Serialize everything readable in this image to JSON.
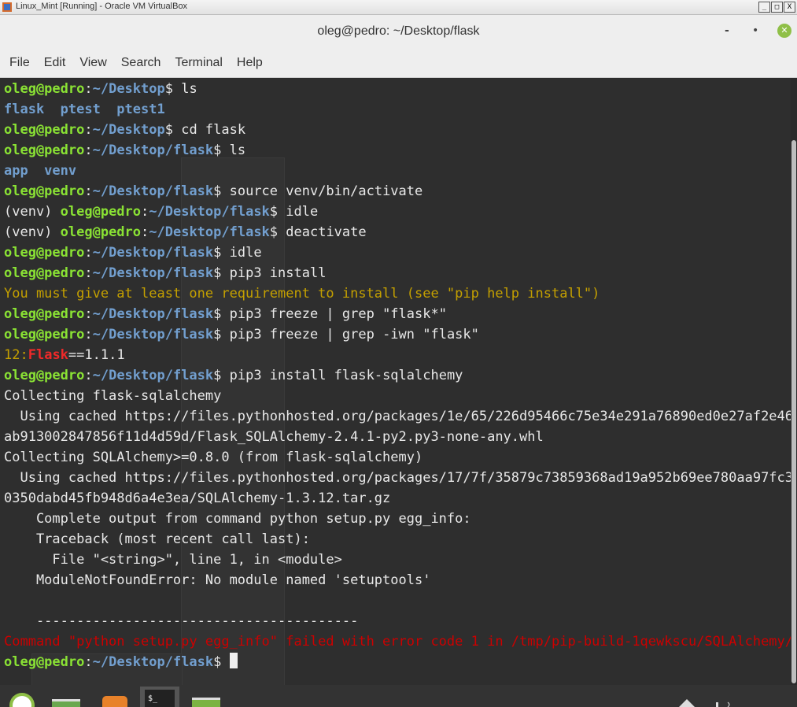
{
  "vbox": {
    "title": "Linux_Mint [Running] - Oracle VM VirtualBox",
    "controls": [
      "_",
      "□",
      "X"
    ]
  },
  "window": {
    "title": "oleg@pedro: ~/Desktop/flask",
    "min": "-",
    "max": "•",
    "close": "✕"
  },
  "menu": [
    "File",
    "Edit",
    "View",
    "Search",
    "Terminal",
    "Help"
  ],
  "prompt": {
    "user": "oleg@pedro",
    "sep": ":"
  },
  "lines": [
    [
      {
        "t": "oleg@pedro",
        "c": "g"
      },
      {
        "t": ":",
        "c": ""
      },
      {
        "t": "~/Desktop",
        "c": "b"
      },
      {
        "t": "$ ls",
        "c": ""
      }
    ],
    [
      {
        "t": "flask  ptest  ptest1",
        "c": "b"
      }
    ],
    [
      {
        "t": "oleg@pedro",
        "c": "g"
      },
      {
        "t": ":",
        "c": ""
      },
      {
        "t": "~/Desktop",
        "c": "b"
      },
      {
        "t": "$ cd flask",
        "c": ""
      }
    ],
    [
      {
        "t": "oleg@pedro",
        "c": "g"
      },
      {
        "t": ":",
        "c": ""
      },
      {
        "t": "~/Desktop/flask",
        "c": "b"
      },
      {
        "t": "$ ls",
        "c": ""
      }
    ],
    [
      {
        "t": "app  venv",
        "c": "b"
      }
    ],
    [
      {
        "t": "oleg@pedro",
        "c": "g"
      },
      {
        "t": ":",
        "c": ""
      },
      {
        "t": "~/Desktop/flask",
        "c": "b"
      },
      {
        "t": "$ source venv/bin/activate",
        "c": ""
      }
    ],
    [
      {
        "t": "(venv) ",
        "c": ""
      },
      {
        "t": "oleg@pedro",
        "c": "g"
      },
      {
        "t": ":",
        "c": ""
      },
      {
        "t": "~/Desktop/flask",
        "c": "b"
      },
      {
        "t": "$ idle",
        "c": ""
      }
    ],
    [
      {
        "t": "(venv) ",
        "c": ""
      },
      {
        "t": "oleg@pedro",
        "c": "g"
      },
      {
        "t": ":",
        "c": ""
      },
      {
        "t": "~/Desktop/flask",
        "c": "b"
      },
      {
        "t": "$ deactivate",
        "c": ""
      }
    ],
    [
      {
        "t": "oleg@pedro",
        "c": "g"
      },
      {
        "t": ":",
        "c": ""
      },
      {
        "t": "~/Desktop/flask",
        "c": "b"
      },
      {
        "t": "$ idle",
        "c": ""
      }
    ],
    [
      {
        "t": "oleg@pedro",
        "c": "g"
      },
      {
        "t": ":",
        "c": ""
      },
      {
        "t": "~/Desktop/flask",
        "c": "b"
      },
      {
        "t": "$ pip3 install",
        "c": ""
      }
    ],
    [
      {
        "t": "You must give at least one requirement to install (see \"pip help install\")",
        "c": "y"
      }
    ],
    [
      {
        "t": "oleg@pedro",
        "c": "g"
      },
      {
        "t": ":",
        "c": ""
      },
      {
        "t": "~/Desktop/flask",
        "c": "b"
      },
      {
        "t": "$ pip3 freeze | grep \"flask*\"",
        "c": ""
      }
    ],
    [
      {
        "t": "oleg@pedro",
        "c": "g"
      },
      {
        "t": ":",
        "c": ""
      },
      {
        "t": "~/Desktop/flask",
        "c": "b"
      },
      {
        "t": "$ pip3 freeze | grep -iwn \"flask\"",
        "c": ""
      }
    ],
    [
      {
        "t": "12",
        "c": "y"
      },
      {
        "t": ":",
        "c": "y"
      },
      {
        "t": "Flask",
        "c": "rb"
      },
      {
        "t": "==1.1.1",
        "c": ""
      }
    ],
    [
      {
        "t": "oleg@pedro",
        "c": "g"
      },
      {
        "t": ":",
        "c": ""
      },
      {
        "t": "~/Desktop/flask",
        "c": "b"
      },
      {
        "t": "$ pip3 install flask-sqlalchemy",
        "c": ""
      }
    ],
    [
      {
        "t": "Collecting flask-sqlalchemy",
        "c": ""
      }
    ],
    [
      {
        "t": "  Using cached https://files.pythonhosted.org/packages/1e/65/226d95466c75e34e291a76890ed0e27af2e46",
        "c": ""
      }
    ],
    [
      {
        "t": "ab913002847856f11d4d59d/Flask_SQLAlchemy-2.4.1-py2.py3-none-any.whl",
        "c": ""
      }
    ],
    [
      {
        "t": "Collecting SQLAlchemy>=0.8.0 (from flask-sqlalchemy)",
        "c": ""
      }
    ],
    [
      {
        "t": "  Using cached https://files.pythonhosted.org/packages/17/7f/35879c73859368ad19a952b69ee780aa97fc3",
        "c": ""
      }
    ],
    [
      {
        "t": "0350dabd45fb948d6a4e3ea/SQLAlchemy-1.3.12.tar.gz",
        "c": ""
      }
    ],
    [
      {
        "t": "    Complete output from command python setup.py egg_info:",
        "c": ""
      }
    ],
    [
      {
        "t": "    Traceback (most recent call last):",
        "c": ""
      }
    ],
    [
      {
        "t": "      File \"<string>\", line 1, in <module>",
        "c": ""
      }
    ],
    [
      {
        "t": "    ModuleNotFoundError: No module named 'setuptools'",
        "c": ""
      }
    ],
    [
      {
        "t": "",
        "c": ""
      }
    ],
    [
      {
        "t": "    ----------------------------------------",
        "c": ""
      }
    ],
    [
      {
        "t": "Command \"python setup.py egg_info\" failed with error code 1 in /tmp/pip-build-1qewkscu/SQLAlchemy/",
        "c": "r"
      }
    ],
    [
      {
        "t": "oleg@pedro",
        "c": "g"
      },
      {
        "t": ":",
        "c": ""
      },
      {
        "t": "~/Desktop/flask",
        "c": "b"
      },
      {
        "t": "$ ",
        "c": ""
      }
    ]
  ],
  "colors": {
    "green": "#8ae234",
    "blue": "#729fcf",
    "yellow": "#c4a000",
    "red": "#cc0000",
    "bg": "#2e2e2e"
  },
  "taskbar_icons": [
    "mint-menu-icon",
    "show-desktop-icon",
    "firefox-icon",
    "terminal-icon",
    "files-icon",
    "network-icon",
    "volume-icon"
  ]
}
